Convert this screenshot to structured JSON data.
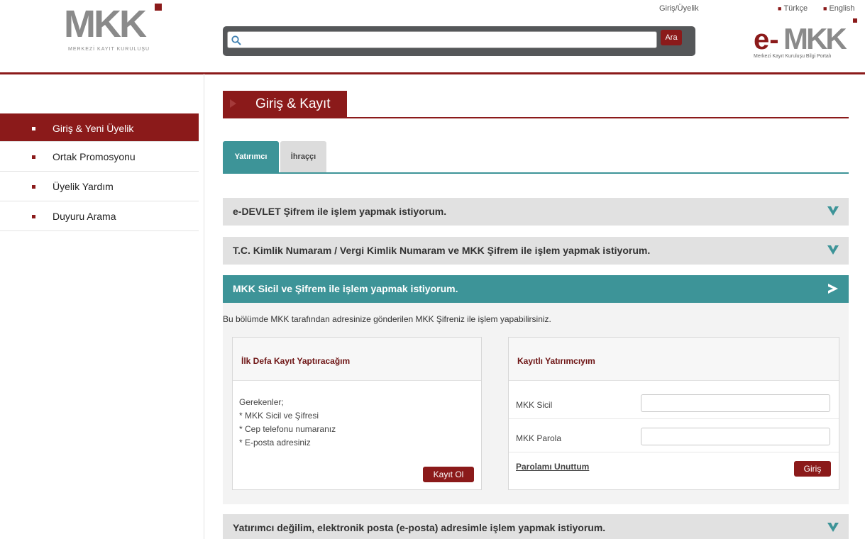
{
  "header": {
    "logo": {
      "text": "MKK",
      "subtitle": "MERKEZİ KAYIT KURULUŞU"
    },
    "search": {
      "placeholder": "",
      "value": "",
      "button_label": "Ara"
    },
    "login_link": "Giriş/Üyelik",
    "languages": [
      "Türkçe",
      "English"
    ],
    "portal_logo": {
      "prefix": "e-",
      "text": "MKK",
      "subtitle": "Merkezi Kayıt Kuruluşu Bilgi Portalı"
    }
  },
  "sidebar": {
    "items": [
      {
        "label": "Giriş & Yeni Üyelik",
        "active": true
      },
      {
        "label": "Ortak Promosyonu",
        "active": false
      },
      {
        "label": "Üyelik Yardım",
        "active": false
      },
      {
        "label": "Duyuru Arama",
        "active": false
      }
    ]
  },
  "page_title": "Giriş & Kayıt",
  "tabs": [
    {
      "label": "Yatırımcı",
      "active": true
    },
    {
      "label": "İhraççı",
      "active": false
    }
  ],
  "accordions": [
    {
      "label": "e-DEVLET Şifrem ile işlem yapmak istiyorum.",
      "open": false
    },
    {
      "label": "T.C. Kimlik Numaram / Vergi Kimlik Numaram ve MKK Şifrem ile işlem yapmak istiyorum.",
      "open": false
    },
    {
      "label": "MKK Sicil ve Şifrem ile işlem yapmak istiyorum.",
      "open": true
    },
    {
      "label": "Yatırımcı değilim, elektronik posta (e-posta) adresimle işlem yapmak istiyorum.",
      "open": false
    }
  ],
  "open_section": {
    "description": "Bu bölümde MKK tarafından adresinize gönderilen MKK Şifreniz ile işlem yapabilirsiniz.",
    "new_registration": {
      "title": "İlk Defa Kayıt Yaptıracağım",
      "requirements_heading": "Gerekenler;",
      "requirements": [
        "* MKK Sicil ve Şifresi",
        "* Cep telefonu numaranız",
        "* E-posta adresiniz"
      ],
      "button_label": "Kayıt Ol"
    },
    "registered": {
      "title": "Kayıtlı Yatırımcıyım",
      "sicil_label": "MKK Sicil",
      "sicil_value": "",
      "password_label": "MKK Parola",
      "password_value": "",
      "forgot_label": "Parolamı Unuttum",
      "button_label": "Giriş"
    }
  },
  "colors": {
    "brand_red": "#8b1a1a",
    "teal": "#3d9498",
    "accordion_gray": "#e1e1e1"
  }
}
